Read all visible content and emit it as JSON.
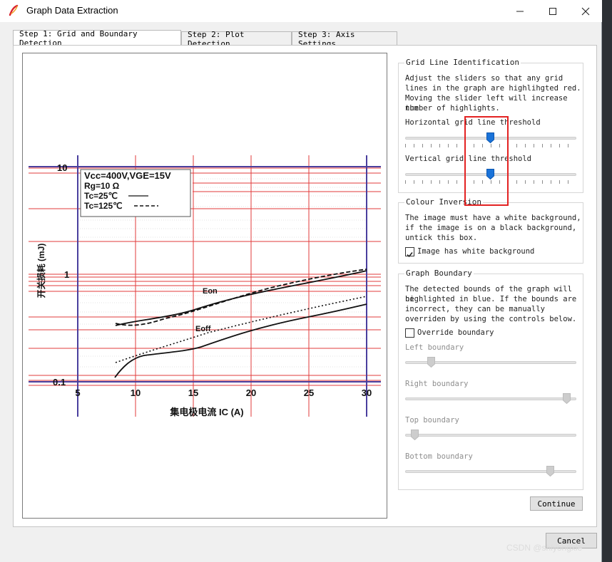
{
  "window": {
    "title": "Graph Data Extraction",
    "minimize_icon": "minimize-icon",
    "maximize_icon": "maximize-icon",
    "close_icon": "close-icon"
  },
  "tabs": [
    {
      "label": "Step 1: Grid and Boundary Detection",
      "active": true
    },
    {
      "label": "Step 2: Plot Detection",
      "active": false
    },
    {
      "label": "Step 3: Axis Settings",
      "active": false
    }
  ],
  "graph": {
    "legend": [
      "Vcc=400V,VGE=15V",
      "Rg=10 Ω",
      "Tc=25℃",
      "Tc=125℃"
    ],
    "y_ticks": [
      "10",
      "1",
      "0.1"
    ],
    "x_ticks": [
      "5",
      "10",
      "15",
      "20",
      "25",
      "30"
    ],
    "x_label": "集电极电流 IC (A)",
    "y_label": "开关损耗 (mJ)",
    "curve_labels": [
      "Eon",
      "Eoff"
    ],
    "colors": {
      "grid_highlight": "#e23b3b",
      "boundary_highlight": "#4040b8"
    }
  },
  "grid_panel": {
    "title": "Grid Line Identification",
    "description": [
      "Adjust the sliders so that any grid",
      "lines in the graph are highlihgted red.",
      "Moving the slider left will increase the",
      "number of highlights."
    ],
    "horizontal_label": "Horizontal grid line threshold",
    "horizontal_value": 0.5,
    "vertical_label": "Vertical grid line threshold",
    "vertical_value": 0.5
  },
  "colour_panel": {
    "title": "Colour Inversion",
    "description": [
      "The image must have a white background,",
      "if the image is on a black background,",
      "untick this box."
    ],
    "checkbox_label": "Image has white background",
    "checked": true
  },
  "boundary_panel": {
    "title": "Graph Boundary",
    "description": [
      "The detected bounds of the graph will be",
      "highlighted in blue. If the bounds are",
      "incorrect, they can be manually",
      "overriden by using the controls below."
    ],
    "override_label": "Override boundary",
    "override_checked": false,
    "left_label": "Left boundary",
    "left_value": 0.15,
    "right_label": "Right boundary",
    "right_value": 0.93,
    "top_label": "Top boundary",
    "top_value": 0.06,
    "bottom_label": "Bottom boundary",
    "bottom_value": 0.85
  },
  "buttons": {
    "continue": "Continue",
    "cancel": "Cancel"
  },
  "watermark": "CSDN @shiyongxie"
}
